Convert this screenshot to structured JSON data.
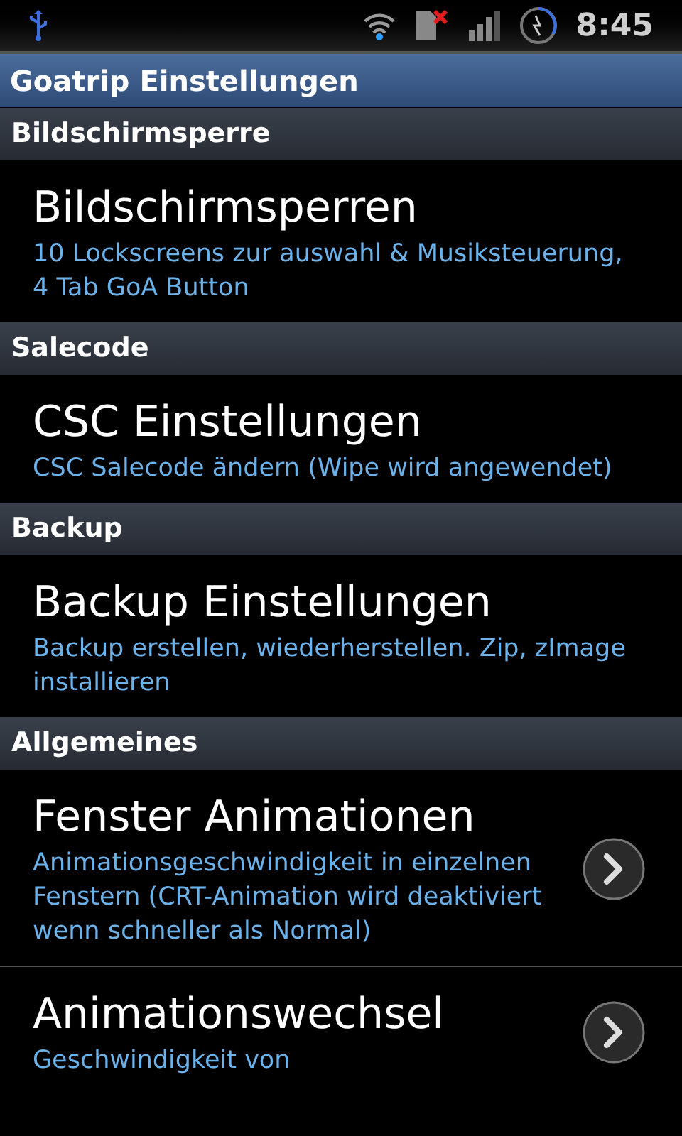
{
  "status_bar": {
    "time": "8:45"
  },
  "title_bar": {
    "title": "Goatrip Einstellungen"
  },
  "sections": [
    {
      "title": "Bildschirmsperre",
      "items": [
        {
          "kind": "plain",
          "title": "Bildschirmsperren",
          "summary": "10 Lockscreens zur auswahl & Musiksteuerung, 4 Tab GoA Button"
        }
      ]
    },
    {
      "title": "Salecode",
      "items": [
        {
          "kind": "plain",
          "title": "CSC Einstellungen",
          "summary": "CSC Salecode ändern (Wipe wird angewendet)"
        }
      ]
    },
    {
      "title": "Backup",
      "items": [
        {
          "kind": "plain",
          "title": "Backup Einstellungen",
          "summary": "Backup erstellen, wiederherstellen. Zip, zImage installieren"
        }
      ]
    },
    {
      "title": "Allgemeines",
      "items": [
        {
          "kind": "arrow",
          "title": "Fenster Animationen",
          "summary": "Animationsgeschwindigkeit in einzelnen Fenstern (CRT-Animation wird deaktiviert wenn schneller als Normal)"
        },
        {
          "kind": "arrow",
          "title": "Animationswechsel",
          "summary": "Geschwindigkeit von"
        }
      ]
    }
  ]
}
